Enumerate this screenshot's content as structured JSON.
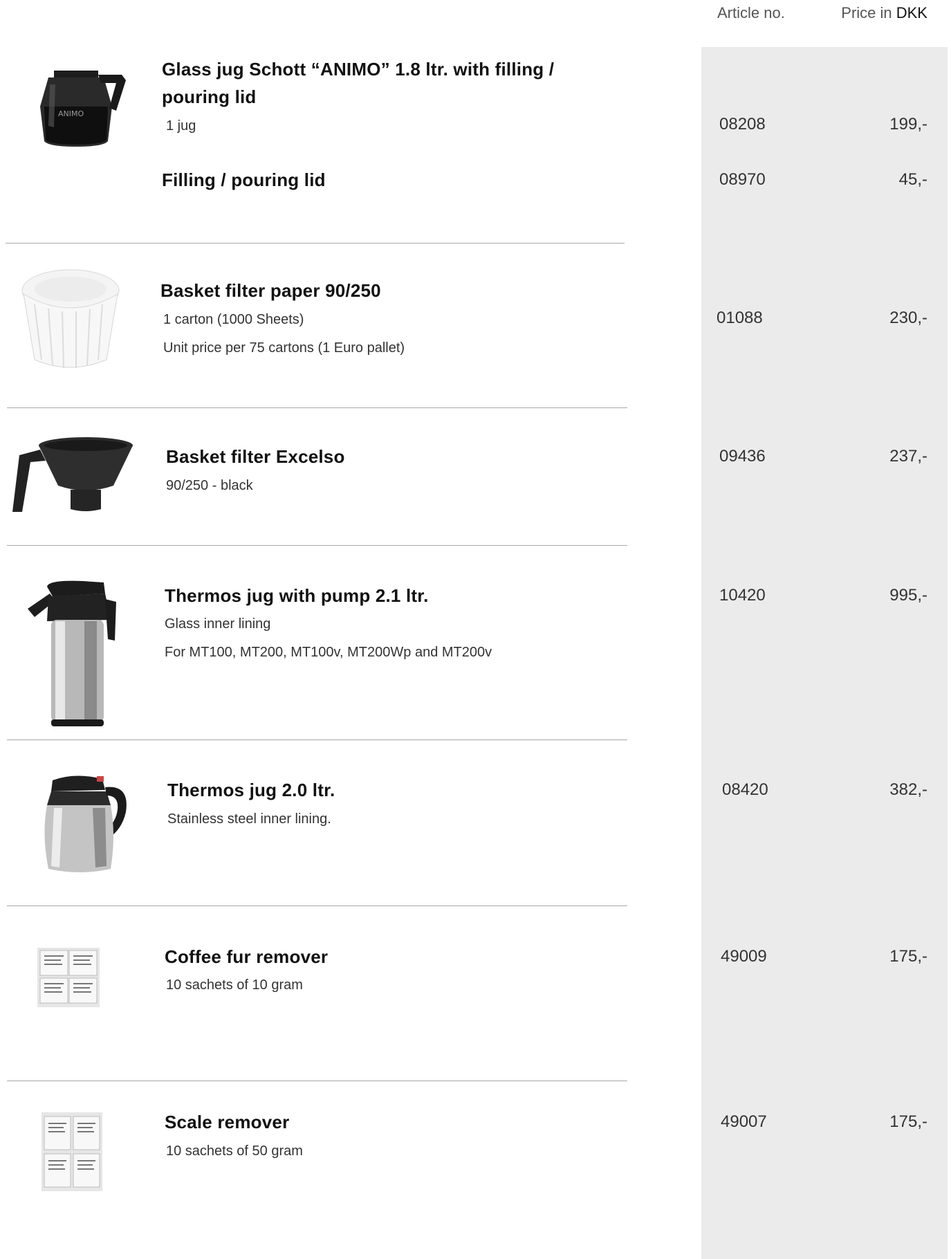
{
  "header": {
    "article_label": "Article no.",
    "price_label_prefix": "Price in ",
    "currency": "DKK"
  },
  "products": [
    {
      "title_line1": "Glass jug Schott “ANIMO” 1.8 ltr. with filling /",
      "title_line2": "pouring lid",
      "details": [
        "1 jug"
      ],
      "article_no": "08208",
      "price": "199,-",
      "logo_text": "ANIMO"
    },
    {
      "title_line1": "Filling / pouring lid",
      "details": [],
      "article_no": "08970",
      "price": "45,-"
    },
    {
      "title_line1": "Basket filter paper 90/250",
      "details": [
        "1 carton (1000 Sheets)",
        "Unit price per 75 cartons (1 Euro pallet)"
      ],
      "article_no": "01088",
      "price": "230,-"
    },
    {
      "title_line1": "Basket filter Excelso",
      "details": [
        "90/250 - black"
      ],
      "article_no": "09436",
      "price": "237,-"
    },
    {
      "title_line1": "Thermos jug with pump 2.1 ltr.",
      "details": [
        "Glass inner lining",
        "For MT100, MT200, MT100v, MT200Wp and MT200v"
      ],
      "article_no": "10420",
      "price": "995,-"
    },
    {
      "title_line1": "Thermos jug 2.0 ltr.",
      "details": [
        "Stainless steel inner lining."
      ],
      "article_no": "08420",
      "price": "382,-"
    },
    {
      "title_line1": "Coffee fur remover",
      "details": [
        "10 sachets of 10 gram"
      ],
      "article_no": "49009",
      "price": "175,-"
    },
    {
      "title_line1": "Scale remover",
      "details": [
        "10 sachets of 50 gram"
      ],
      "article_no": "49007",
      "price": "175,-"
    }
  ]
}
